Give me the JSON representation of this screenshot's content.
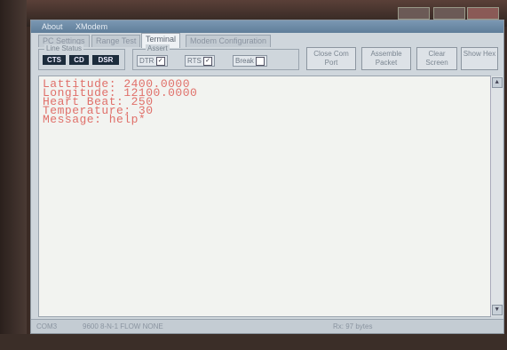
{
  "menu": {
    "items": [
      "About",
      "XModem"
    ]
  },
  "tabs": [
    "PC Settings",
    "Range Test",
    "Terminal",
    "Modem Configuration"
  ],
  "active_tab": "Terminal",
  "line_status": {
    "title": "Line Status",
    "lamps": [
      "CTS",
      "CD",
      "DSR"
    ]
  },
  "assert": {
    "title": "Assert",
    "dtr": {
      "label": "DTR",
      "checked": true
    },
    "rts": {
      "label": "RTS",
      "checked": true
    },
    "break": {
      "label": "Break",
      "checked": false
    }
  },
  "buttons": {
    "close_com_port": "Close Com Port",
    "assemble_packet": "Assemble Packet",
    "clear_screen": "Clear Screen",
    "show_hex": "Show Hex"
  },
  "terminal": {
    "lines": [
      "Lattitude: 2400.0000",
      "Longitude: 12100.0000",
      "Heart Beat: 250",
      "Temperature: 30",
      "Message: help*"
    ]
  },
  "status": {
    "port": "COM3",
    "settings": "9600 8-N-1 FLOW NONE",
    "rx": "Rx: 97 bytes"
  },
  "colors": {
    "terminal_text": "#e0706a",
    "window_bg": "#cfd6dc",
    "menubar": "#6f8ca8"
  },
  "icons": {
    "check": "✓",
    "scroll_up": "▲",
    "scroll_down": "▼"
  }
}
